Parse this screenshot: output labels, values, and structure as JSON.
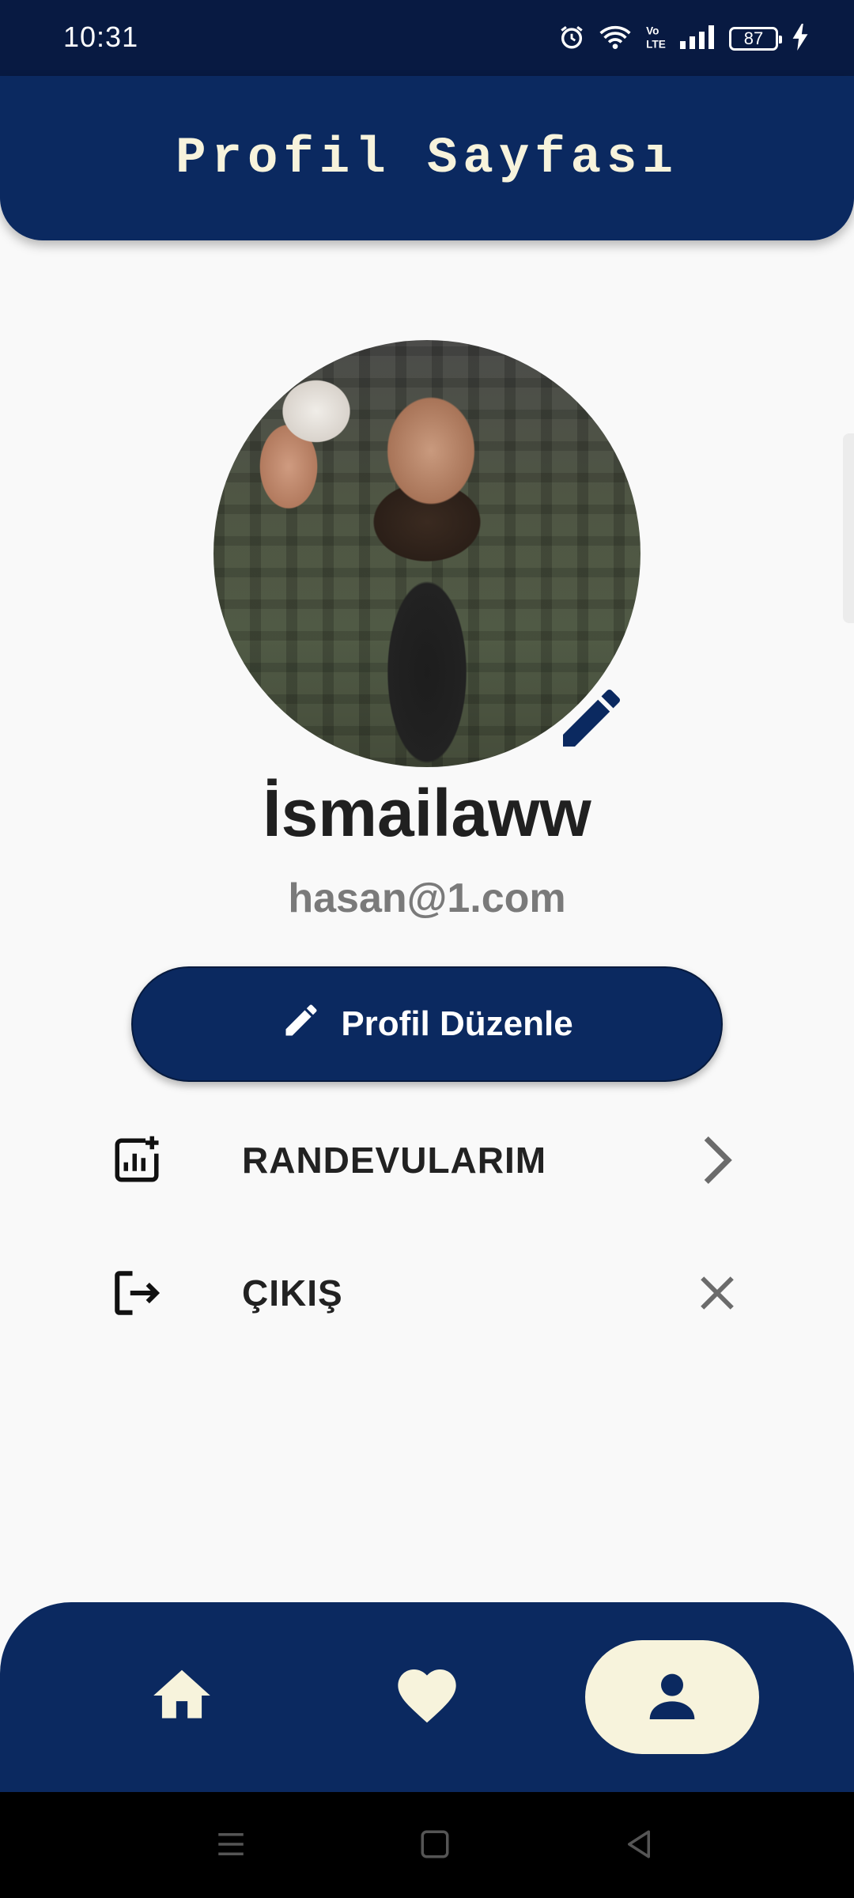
{
  "status_bar": {
    "time": "10:31",
    "battery": "87",
    "icons": [
      "alarm-icon",
      "wifi-icon",
      "volte-icon",
      "signal-icon",
      "battery-icon",
      "charging-icon"
    ]
  },
  "header": {
    "title": "Profil Sayfası"
  },
  "profile": {
    "name": "İsmailaww",
    "email": "hasan@1.com",
    "edit_button_label": "Profil Düzenle"
  },
  "menu": {
    "items": [
      {
        "label": "RANDEVULARIM",
        "icon": "appointments-icon",
        "trailing": "chevron-right-icon"
      },
      {
        "label": "ÇIKIŞ",
        "icon": "logout-icon",
        "trailing": "close-icon"
      }
    ]
  },
  "bottom_nav": {
    "items": [
      {
        "icon": "home-icon",
        "selected": false
      },
      {
        "icon": "heart-icon",
        "selected": false
      },
      {
        "icon": "person-icon",
        "selected": true
      }
    ]
  },
  "colors": {
    "primary": "#0b2960",
    "status_bar": "#081a42",
    "accent_cream": "#f7f3dc",
    "background": "#f9f9f9",
    "email_gray": "#7a7a7a"
  }
}
